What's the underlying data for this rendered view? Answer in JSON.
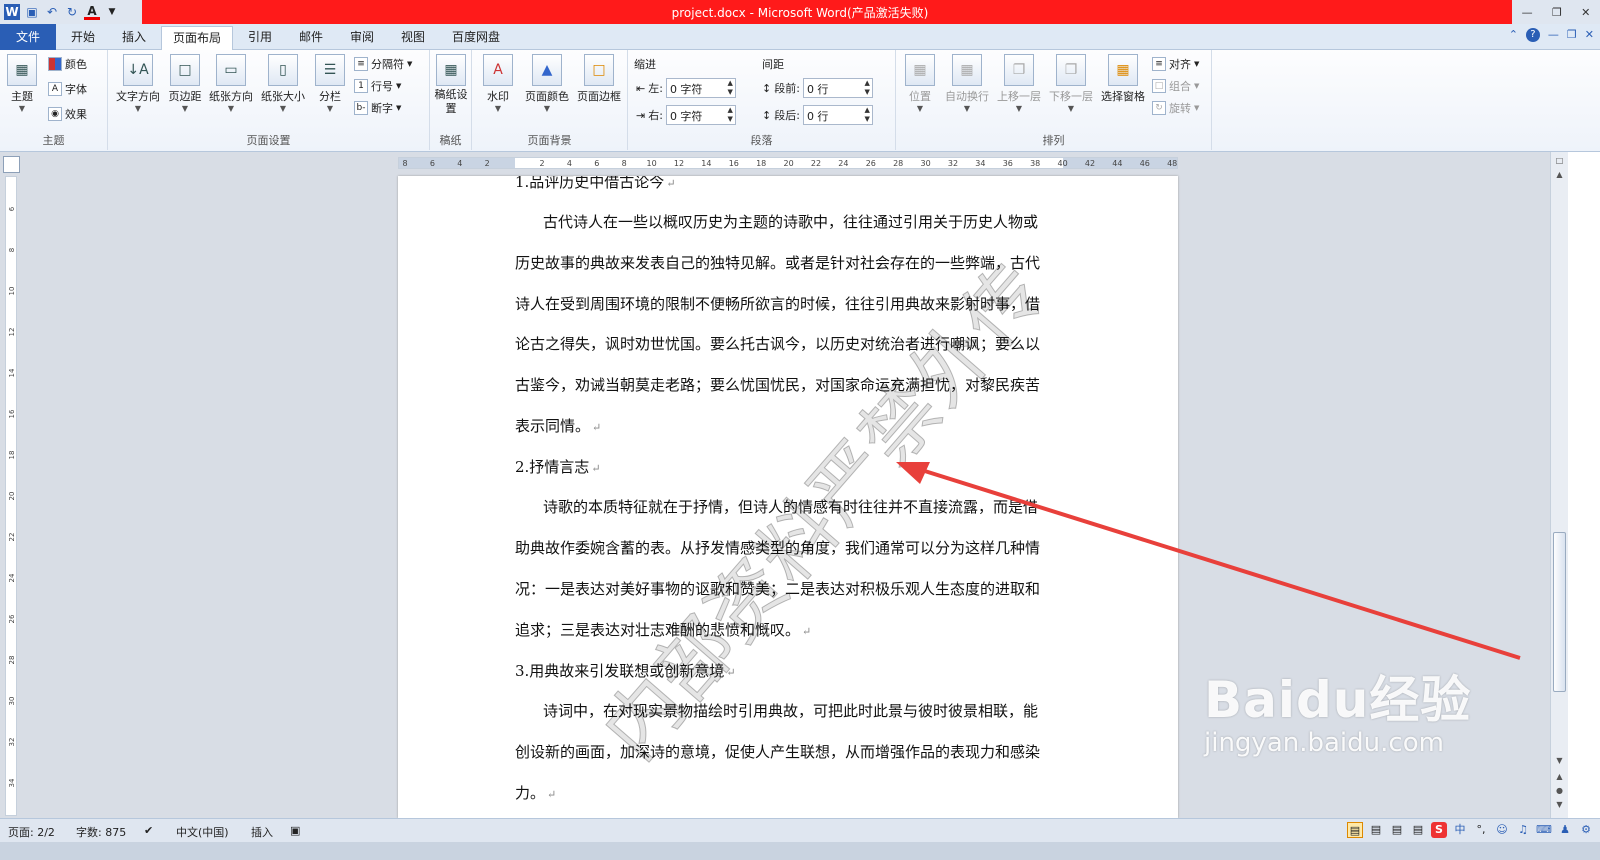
{
  "window": {
    "title": "project.docx - Microsoft Word(产品激活失败)"
  },
  "tabs": [
    "文件",
    "开始",
    "插入",
    "页面布局",
    "引用",
    "邮件",
    "审阅",
    "视图",
    "百度网盘"
  ],
  "ribbon": {
    "theme_group": {
      "label": "主题",
      "theme": "主题",
      "colors": "颜色",
      "fonts": "字体",
      "effects": "效果"
    },
    "page_setup": {
      "label": "页面设置",
      "text_direction": "文字方向",
      "margins": "页边距",
      "orientation": "纸张方向",
      "size": "纸张大小",
      "columns": "分栏",
      "breaks": "分隔符",
      "line_numbers": "行号",
      "hyphenation": "断字"
    },
    "manuscript": {
      "label": "稿纸",
      "setup": "稿纸设置"
    },
    "page_background": {
      "label": "页面背景",
      "watermark": "水印",
      "page_color": "页面颜色",
      "page_borders": "页面边框"
    },
    "paragraph": {
      "label": "段落",
      "indent": "缩进",
      "spacing": "间距",
      "left_label": "左:",
      "right_label": "右:",
      "before_label": "段前:",
      "after_label": "段后:",
      "left_value": "0 字符",
      "right_value": "0 字符",
      "before_value": "0 行",
      "after_value": "0 行"
    },
    "arrange": {
      "label": "排列",
      "position": "位置",
      "wrap": "自动换行",
      "bring_forward": "上移一层",
      "send_backward": "下移一层",
      "selection_pane": "选择窗格",
      "align": "对齐",
      "group": "组合",
      "rotate": "旋转"
    }
  },
  "ruler": {
    "h_ticks": [
      "8",
      "6",
      "4",
      "2",
      "",
      "2",
      "4",
      "6",
      "8",
      "10",
      "12",
      "14",
      "16",
      "18",
      "20",
      "22",
      "24",
      "26",
      "28",
      "30",
      "32",
      "34",
      "36",
      "38",
      "40",
      "42",
      "44",
      "46",
      "48"
    ],
    "v_ticks": [
      "6",
      "8",
      "10",
      "12",
      "14",
      "16",
      "18",
      "20",
      "22",
      "24",
      "26",
      "28",
      "30",
      "32",
      "34",
      "36",
      "38"
    ]
  },
  "document": {
    "heading1": "1.品评历史中借古论今",
    "para1": [
      "古代诗人在一些以概叹历史为主题的诗歌中，往往通过引用关于历史人物或",
      "历史故事的典故来发表自己的独特见解。或者是针对社会存在的一些弊端，古代",
      "诗人在受到周围环境的限制不便畅所欲言的时候，往往引用典故来影射时事，借",
      "论古之得失，讽时劝世忧国。要么托古讽今，以历史对统治者进行嘲讽；要么以",
      "古鉴今，劝诫当朝莫走老路；要么忧国忧民，对国家命运充满担忧，对黎民疾苦",
      "表示同情。"
    ],
    "heading2": "2.抒情言志",
    "para2": [
      "诗歌的本质特征就在于抒情，但诗人的情感有时往往并不直接流露，而是借",
      "助典故作委婉含蓄的表。从抒发情感类型的角度，我们通常可以分为这样几种情",
      "况：一是表达对美好事物的讴歌和赞美；二是表达对积极乐观人生态度的进取和",
      "追求；三是表达对壮志难酬的悲愤和慨叹。"
    ],
    "heading3": "3.用典故来引发联想或创新意境",
    "para3": [
      "诗词中，在对现实景物描绘时引用典故，可把此时此景与彼时彼景相联，能",
      "创设新的画面，加深诗的意境，促使人产生联想，从而增强作品的表现力和感染",
      "力。"
    ],
    "para_mark": "↵",
    "watermark_text": "内部资料严禁外传"
  },
  "statusbar": {
    "page": "页面: 2/2",
    "words": "字数: 875",
    "language": "中文(中国)",
    "mode": "插入"
  },
  "overlay": {
    "baidu_logo": "Baidu经验",
    "baidu_url": "jingyan.baidu.com",
    "arrow_color": "#e8403b"
  }
}
